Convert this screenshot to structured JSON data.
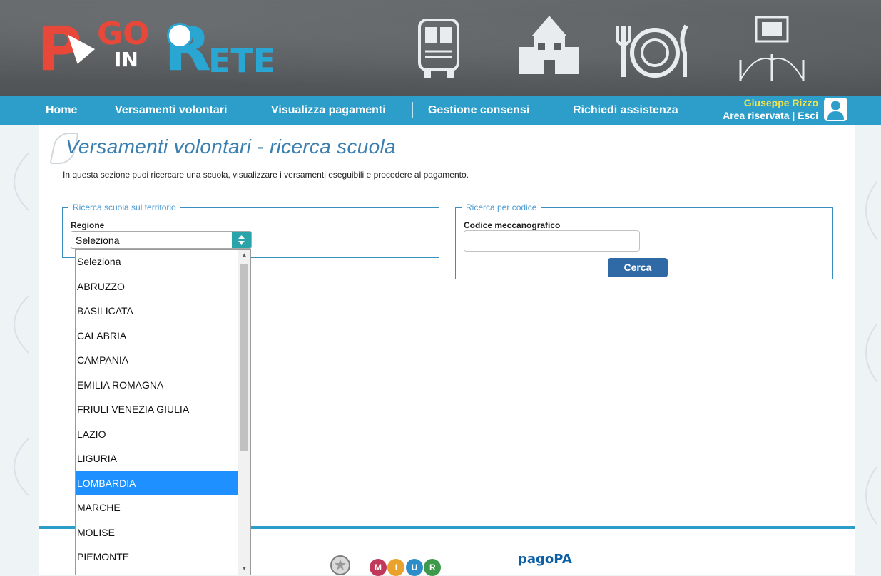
{
  "logo": {
    "p": "P",
    "go": "GO",
    "in": "IN",
    "r": "R",
    "ete": "ETE"
  },
  "nav": {
    "items": [
      "Home",
      "Versamenti volontari",
      "Visualizza pagamenti",
      "Gestione consensi",
      "Richiedi assistenza"
    ],
    "user_name": "Giuseppe Rizzo",
    "area_riservata": "Area riservata",
    "separator": "|",
    "esci": "Esci"
  },
  "page": {
    "title": "Versamenti volontari - ricerca scuola",
    "intro": "In questa sezione puoi ricercare una scuola, visualizzare i versamenti eseguibili e procedere al pagamento."
  },
  "territorio": {
    "legend": "Ricerca scuola sul territorio",
    "regione_label": "Regione",
    "selected": "Seleziona"
  },
  "codice": {
    "legend": "Ricerca per codice",
    "label": "Codice meccanografico",
    "value": "",
    "button": "Cerca"
  },
  "dropdown": {
    "options": [
      "Seleziona",
      "ABRUZZO",
      "BASILICATA",
      "CALABRIA",
      "CAMPANIA",
      "EMILIA ROMAGNA",
      "FRIULI VENEZIA GIULIA",
      "LAZIO",
      "LIGURIA",
      "LOMBARDIA",
      "MARCHE",
      "MOLISE",
      "PIEMONTE"
    ],
    "highlighted": "LOMBARDIA"
  },
  "footer": {
    "miur_letters": [
      "M",
      "I",
      "U",
      "R"
    ],
    "pagopa": "pagoPA"
  },
  "colors": {
    "nav_bg": "#2d9ec9",
    "title": "#3b7fb0",
    "highlight": "#1e90ff",
    "button": "#2f6aa6",
    "user_name": "#f4e24d"
  }
}
